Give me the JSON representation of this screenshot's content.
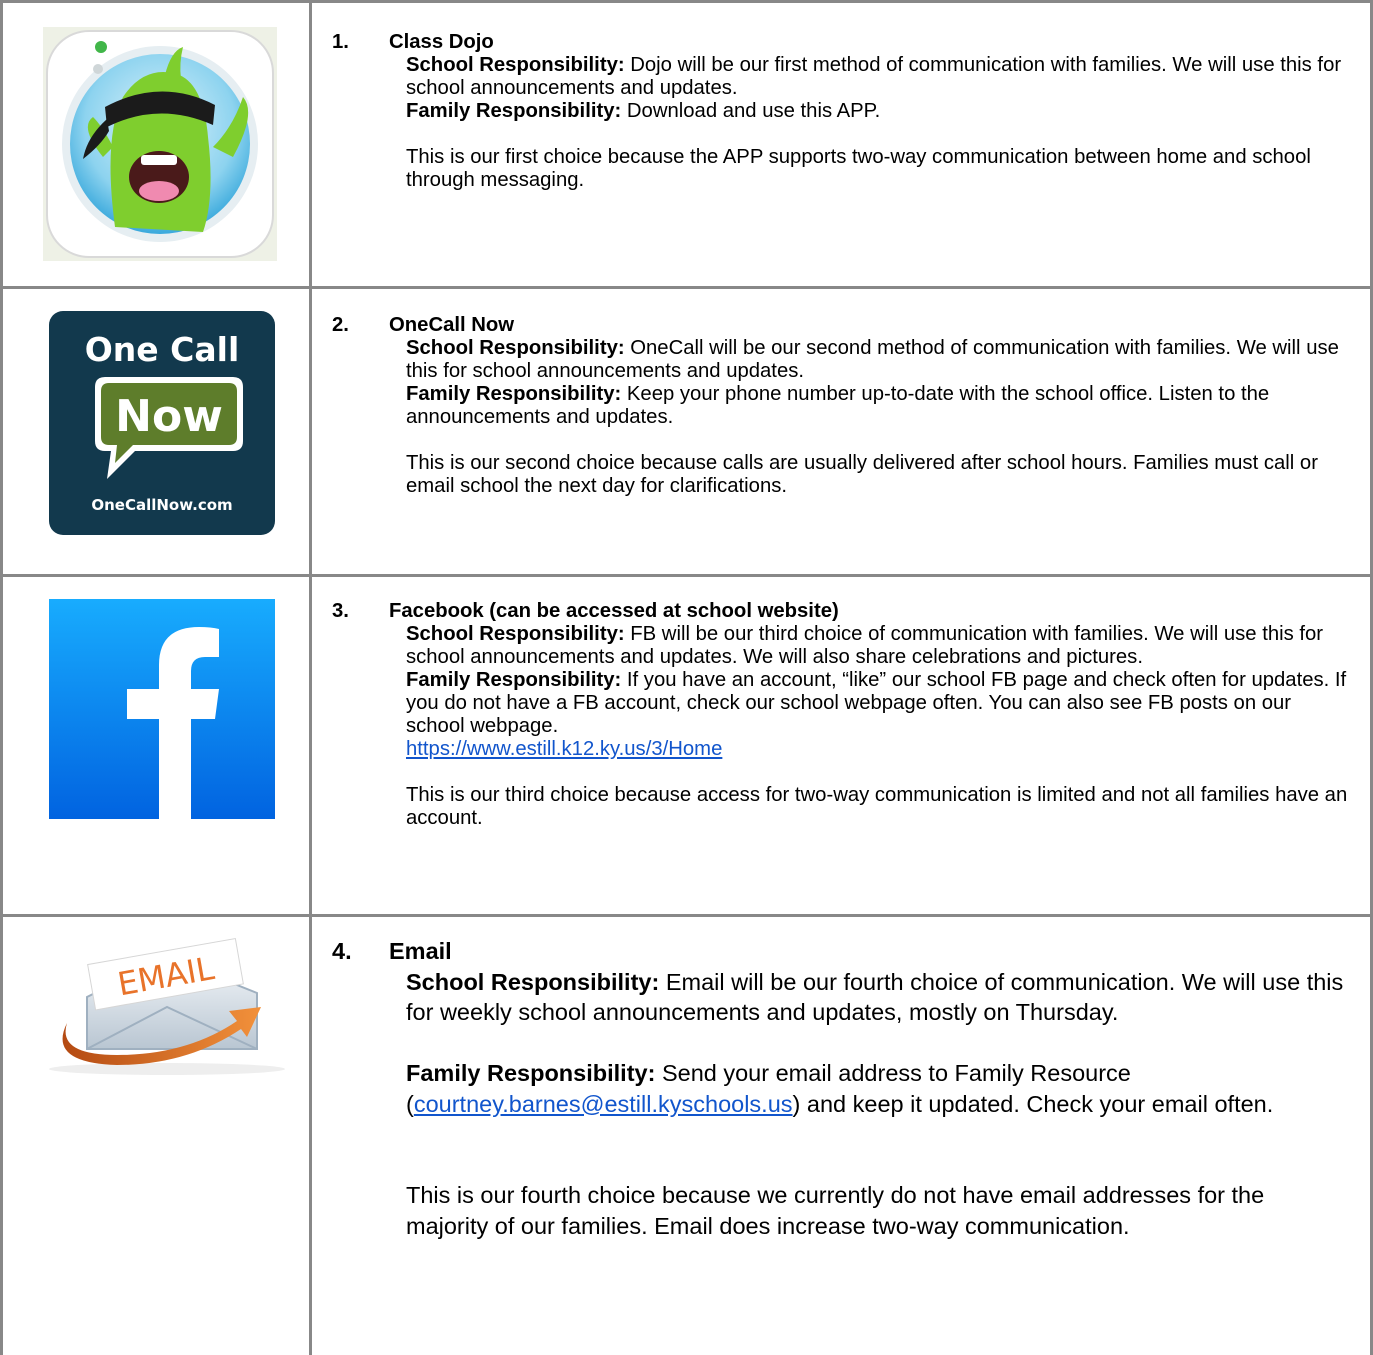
{
  "items": [
    {
      "number": "1.",
      "title": "Class Dojo",
      "icon": "class-dojo-monster-icon",
      "school_label": "School Responsibility:",
      "school_text": " Dojo will be our first method of communication with families. We will use this for school announcements and updates.",
      "family_label": "Family Responsibility:",
      "family_text": " Download and use this APP.",
      "reason": "This is our first choice because the APP supports two-way communication between home and school through messaging."
    },
    {
      "number": "2.",
      "title": "OneCall Now",
      "icon": "one-call-now-logo-icon",
      "logo_line1": "One Call",
      "logo_line2": "Now",
      "logo_footer": "OneCallNow.com",
      "school_label": "School Responsibility:",
      "school_text": " OneCall will be our second method of communication with families.  We will use this for school announcements and updates.",
      "family_label": "Family Responsibility:",
      "family_text": " Keep your phone number up-to-date with the school office.  Listen to the announcements and updates.",
      "reason": "This is our second choice because calls are usually delivered after school hours.  Families must call or email school the next day for clarifications."
    },
    {
      "number": "3.",
      "title": "Facebook (can be accessed at school website)",
      "icon": "facebook-f-logo-icon",
      "logo_letter": "f",
      "school_label": "School Responsibility:",
      "school_text": " FB will be our third choice of communication with families.  We will use this for school announcements and updates.  We will also share celebrations and pictures.",
      "family_label": "Family Responsibility:",
      "family_text": " If you have an account, “like” our school FB page and check often for updates.  If you do not have a FB account, check our school webpage often.  You can also see FB posts on our school webpage.",
      "link": "https://www.estill.k12.ky.us/3/Home",
      "reason": "This is our third choice because access for two-way communication is limited and not all families have an account."
    },
    {
      "number": "4.",
      "title": "Email",
      "icon": "email-envelope-arrow-icon",
      "logo_word": "EMAIL",
      "school_label": "School Responsibility:",
      "school_text": " Email will be our fourth choice of communication.  We will use this for weekly school announcements and updates, mostly on Thursday.",
      "family_label": "Family Responsibility:",
      "family_text_before": " Send your email address to Family Resource (",
      "email_link": "courtney.barnes@estill.kyschools.us",
      "family_text_after": ") and keep it updated.  Check your email often.",
      "reason": "This is our fourth choice because we currently do not have email addresses for the majority of our families.  Email does increase two-way communication."
    }
  ],
  "colors": {
    "border": "#888888",
    "link": "#1155cc",
    "facebook_top": "#18acfe",
    "facebook_bottom": "#0163e0",
    "onecall_bg": "#12394d",
    "onecall_green": "#5e7d2b",
    "dojo_green": "#7fce2e",
    "email_orange": "#e8732a"
  }
}
